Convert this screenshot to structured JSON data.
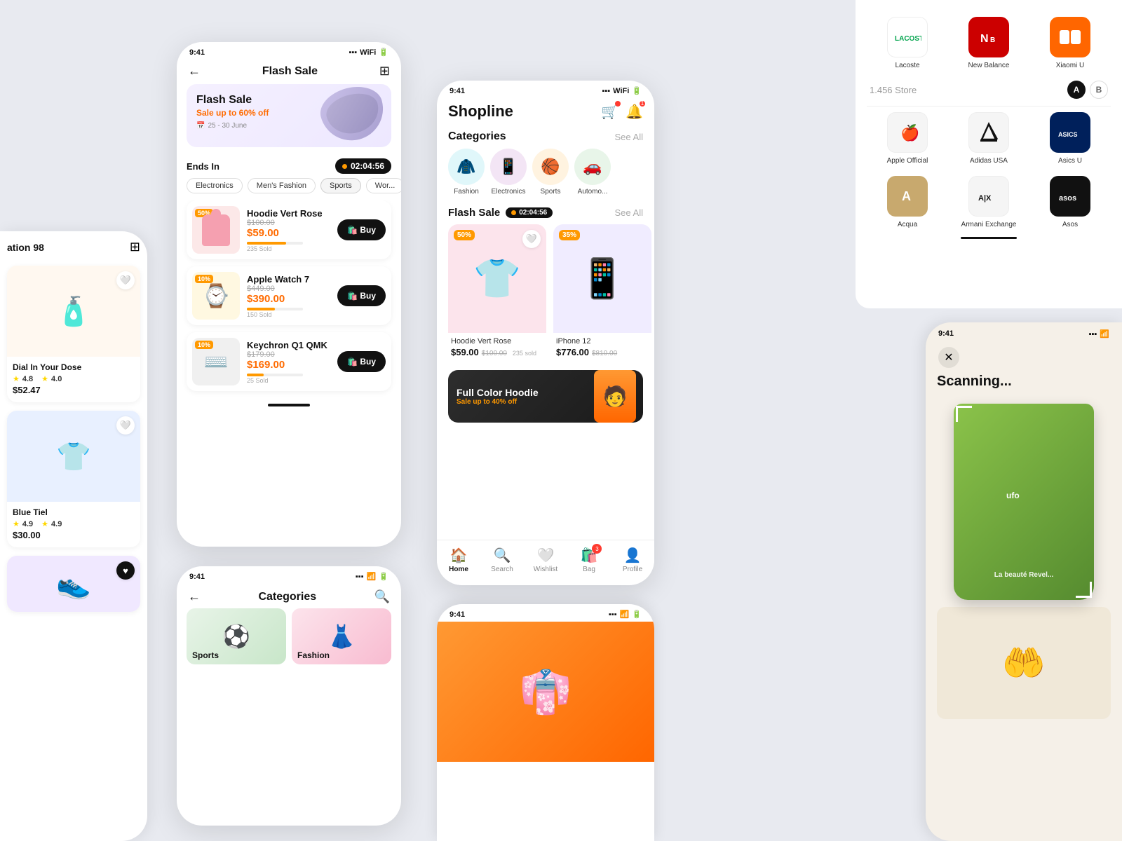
{
  "bg": "#e8eaf0",
  "phone_flash_sale": {
    "status_time": "9:41",
    "back": "←",
    "title": "Flash Sale",
    "banner": {
      "title": "Flash Sale",
      "subtitle": "Sale up to 60% off",
      "date": "25 - 30 June"
    },
    "ends_in": "Ends In",
    "timer": "02:04:56",
    "chips": [
      "Electronics",
      "Men's Fashion",
      "Sports",
      "Wor..."
    ],
    "products": [
      {
        "name": "Hoodie Vert Rose",
        "price_old": "$100.00",
        "price_new": "$59.00",
        "discount": "50%",
        "sold": "235 Sold",
        "sold_pct": 70,
        "emoji": "👕",
        "bg": "hoodie"
      },
      {
        "name": "Apple Watch 7",
        "price_old": "$449.00",
        "price_new": "$390.00",
        "discount": "10%",
        "sold": "150 Sold",
        "sold_pct": 50,
        "emoji": "⌚",
        "bg": "watch"
      },
      {
        "name": "Keychron Q1 QMK",
        "price_old": "$179.00",
        "price_new": "$169.00",
        "discount": "10%",
        "sold": "25 Sold",
        "sold_pct": 30,
        "emoji": "⌨️",
        "bg": "keyboard"
      }
    ],
    "buy_label": "Buy"
  },
  "phone_shopline": {
    "status_time": "9:41",
    "logo": "Shopline",
    "categories_title": "Categories",
    "see_all": "See All",
    "categories": [
      {
        "emoji": "🧥",
        "label": "Fashion",
        "bg": "#e0f7fa"
      },
      {
        "emoji": "📱",
        "label": "Electronics",
        "bg": "#f3e5f5"
      },
      {
        "emoji": "🏀",
        "label": "Sports",
        "bg": "#fff3e0"
      },
      {
        "emoji": "🚗",
        "label": "Automo...",
        "bg": "#e8f5e9"
      }
    ],
    "flash_sale_title": "Flash Sale",
    "timer": "02:04:56",
    "flash_products": [
      {
        "name": "Hoodie Vert Rose",
        "price": "$59.00",
        "price_old": "$100.00",
        "sold": "235 sold",
        "discount": "50%",
        "emoji": "👕",
        "bg": "flash-img-hoodie"
      },
      {
        "name": "iPhone 12",
        "price": "$776.00",
        "price_old": "$810.00",
        "sold": "",
        "discount": "35%",
        "emoji": "📱",
        "bg": "flash-img-phone"
      }
    ],
    "promo": {
      "title": "Full Color Hoodie",
      "sub": "Sale up to 40% off"
    },
    "nav": [
      {
        "icon": "🏠",
        "label": "Home",
        "active": true
      },
      {
        "icon": "🔍",
        "label": "Search",
        "active": false
      },
      {
        "icon": "🤍",
        "label": "Wishlist",
        "active": false
      },
      {
        "icon": "🛍️",
        "label": "Bag",
        "active": false,
        "badge": "3"
      },
      {
        "icon": "👤",
        "label": "Profile",
        "active": false
      }
    ]
  },
  "brand_panel": {
    "brands_row1": [
      {
        "name": "Lacoste",
        "class": "lacoste-logo",
        "text": "LACOSTE",
        "color": "#00a34c"
      },
      {
        "name": "New Balance",
        "class": "nb-logo",
        "text": "NB",
        "color": "#fff"
      },
      {
        "name": "Xiaomi U",
        "class": "xiaomi-logo",
        "text": "Mi",
        "color": "#fff"
      }
    ],
    "stores_count": "1.456 Store",
    "alpha_a": "A",
    "alpha_b": "B",
    "brands_row2": [
      {
        "name": "Apple Official",
        "class": "apple-logo",
        "text": "🍎",
        "color": "#111"
      },
      {
        "name": "Adidas USA",
        "class": "adidas-logo",
        "text": "⬛",
        "color": "#111"
      },
      {
        "name": "Asics U",
        "class": "asics-logo",
        "text": "asics",
        "color": "#fff"
      }
    ],
    "brands_row3": [
      {
        "name": "Acqua",
        "class": "acqua-logo",
        "text": "A",
        "color": "#fff"
      },
      {
        "name": "Armani Exchange",
        "class": "armani-logo",
        "text": "A|X",
        "color": "#111"
      },
      {
        "name": "Asos",
        "class": "asos-logo",
        "text": "asos",
        "color": "#fff"
      }
    ]
  },
  "left_phone": {
    "label": "ation 98",
    "products": [
      {
        "name": "Dial In Your Dose",
        "price": "$52.47",
        "rating": "4.8",
        "rating2": "4.0",
        "emoji": "🧴",
        "bg": "#fff8f0"
      },
      {
        "name": "Blue Tiel",
        "price": "$30.00",
        "rating": "4.9",
        "rating2": "4.9",
        "emoji": "👕",
        "bg": "#e8f0ff"
      }
    ]
  },
  "phone_categories": {
    "status_time": "9:41",
    "title": "Categories",
    "items": [
      {
        "label": "Sports",
        "emoji": "⚽",
        "bg": "cat-bg-sports"
      },
      {
        "label": "Fashion",
        "emoji": "👗",
        "bg": "cat-bg-fashion"
      }
    ]
  },
  "phone_scanning": {
    "status_time": "9:41",
    "scanning_text": "Scanning...",
    "product_text": "ufo\nLa beauté Revel..."
  },
  "phone_bottom": {
    "status_time": "9:41",
    "product_emoji": "👘"
  }
}
